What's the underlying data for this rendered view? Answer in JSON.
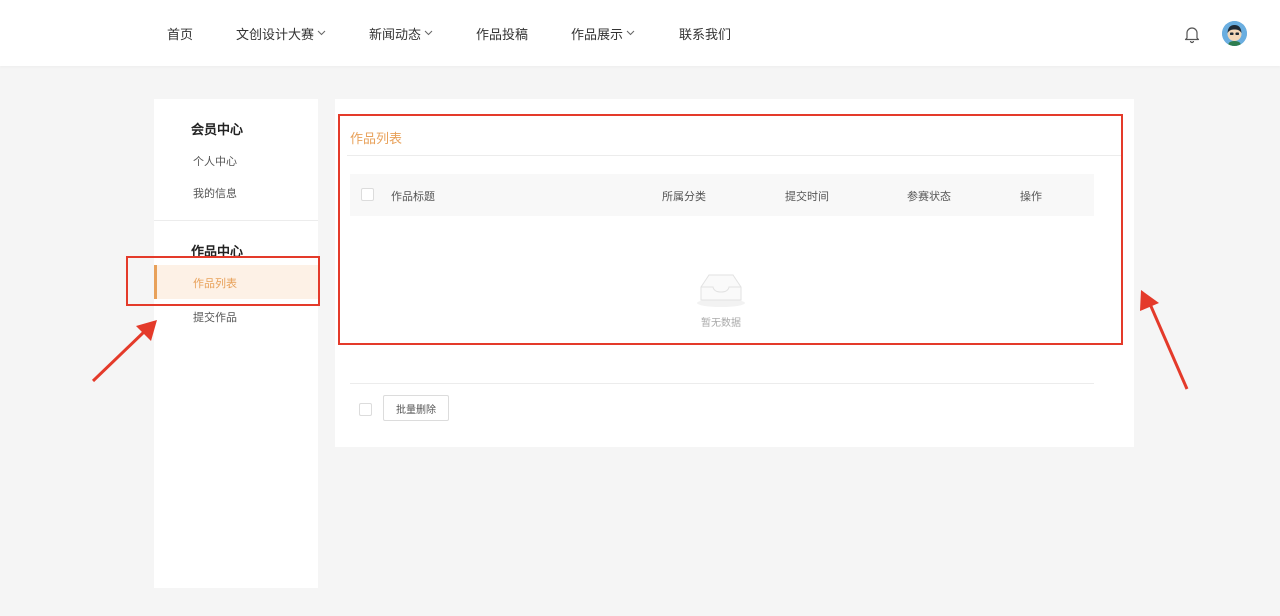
{
  "nav": {
    "items": [
      {
        "label": "首页",
        "has_dropdown": false
      },
      {
        "label": "文创设计大赛",
        "has_dropdown": true
      },
      {
        "label": "新闻动态",
        "has_dropdown": true
      },
      {
        "label": "作品投稿",
        "has_dropdown": false
      },
      {
        "label": "作品展示",
        "has_dropdown": true
      },
      {
        "label": "联系我们",
        "has_dropdown": false
      }
    ],
    "icons": {
      "notification": "bell-icon",
      "user": "avatar"
    }
  },
  "sidebar": {
    "section1_heading": "会员中心",
    "section1_items": [
      "个人中心",
      "我的信息"
    ],
    "section2_heading": "作品中心",
    "active_item": "作品列表",
    "section2_items": [
      "提交作品"
    ]
  },
  "main": {
    "title": "作品列表",
    "columns": [
      "作品标题",
      "所属分类",
      "提交时间",
      "参赛状态",
      "操作"
    ],
    "empty_text": "暂无数据",
    "batch_delete_label": "批量删除"
  },
  "colors": {
    "accent": "#e8a15a",
    "active_bg": "#fdf1e6",
    "annotation": "#e43a2a",
    "page_bg": "#f5f5f5"
  }
}
